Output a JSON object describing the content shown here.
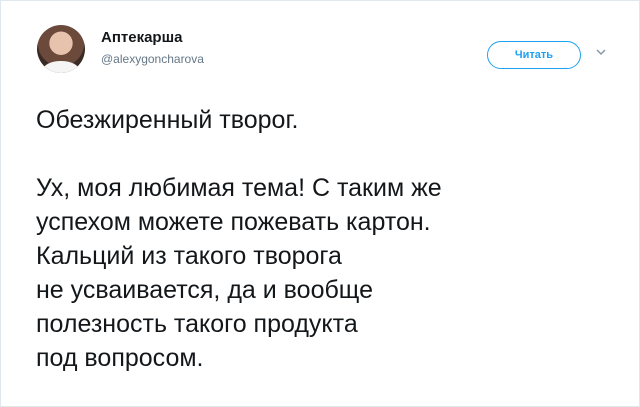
{
  "tweet": {
    "author_name": "Аптекарша",
    "author_handle": "@alexygoncharova",
    "follow_label": "Читать",
    "paragraph1": "Обезжиренный творог.",
    "paragraph2_lines": [
      "Ух, моя любимая тема! С таким же",
      "успехом можете пожевать картон.",
      "Кальций из такого творога",
      "не усваивается, да и вообще",
      "полезность такого продукта",
      "под вопросом."
    ]
  },
  "icons": {
    "avatar": "avatar-photo",
    "menu": "chevron-down-icon"
  },
  "colors": {
    "accent": "#1da1f2",
    "text": "#14171a",
    "muted": "#657786"
  }
}
